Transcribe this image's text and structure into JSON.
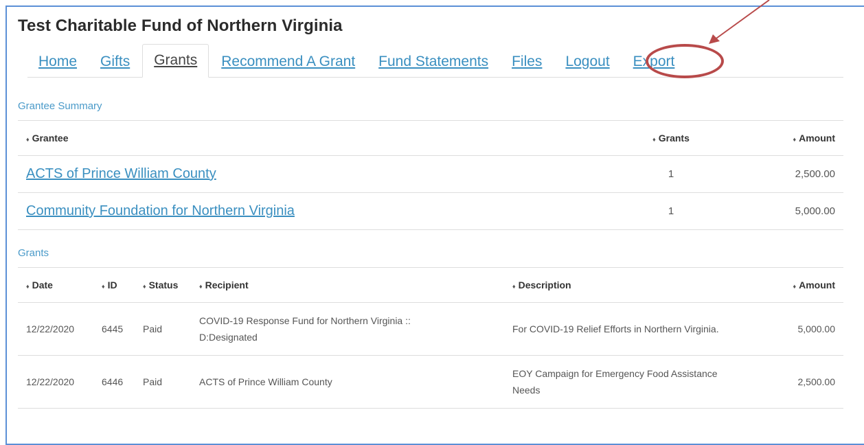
{
  "page": {
    "title": "Test Charitable Fund of Northern Virginia"
  },
  "nav": {
    "tabs": [
      {
        "label": "Home"
      },
      {
        "label": "Gifts"
      },
      {
        "label": "Grants"
      },
      {
        "label": "Recommend A Grant"
      },
      {
        "label": "Fund Statements"
      },
      {
        "label": "Files"
      },
      {
        "label": "Logout"
      },
      {
        "label": "Export"
      }
    ],
    "active": "Grants"
  },
  "grantee_summary": {
    "heading": "Grantee Summary",
    "columns": [
      "Grantee",
      "Grants",
      "Amount"
    ],
    "rows": [
      {
        "grantee": "ACTS of Prince William County",
        "grants": "1",
        "amount": "2,500.00"
      },
      {
        "grantee": "Community Foundation for Northern Virginia",
        "grants": "1",
        "amount": "5,000.00"
      }
    ]
  },
  "grants": {
    "heading": "Grants",
    "columns": [
      "Date",
      "ID",
      "Status",
      "Recipient",
      "Description",
      "Amount"
    ],
    "rows": [
      {
        "date": "12/22/2020",
        "id": "6445",
        "status": "Paid",
        "recipient_line1": "COVID-19 Response Fund for Northern Virginia ::",
        "recipient_line2": "D:Designated",
        "description_line1": "For COVID-19 Relief Efforts in Northern Virginia.",
        "description_line2": "",
        "amount": "5,000.00"
      },
      {
        "date": "12/22/2020",
        "id": "6446",
        "status": "Paid",
        "recipient_line1": "ACTS of Prince William County",
        "recipient_line2": "",
        "description_line1": "EOY Campaign for Emergency Food Assistance",
        "description_line2": "Needs",
        "amount": "2,500.00"
      }
    ]
  },
  "sort_glyph": "♦",
  "colors": {
    "link": "#3a8fc0",
    "annotation": "#b84a4a",
    "frame": "#5b8fd6"
  }
}
